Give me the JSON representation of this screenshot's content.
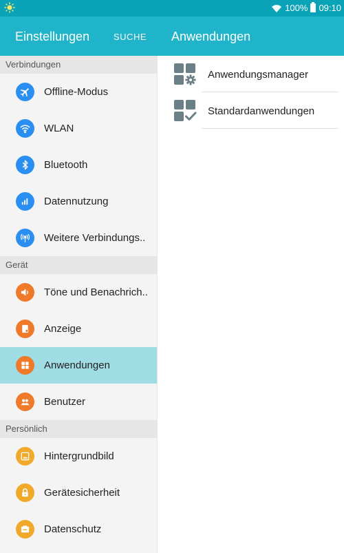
{
  "status_bar": {
    "battery_text": "100%",
    "time": "09:10",
    "icons": [
      "sun-icon",
      "wifi-icon",
      "battery-icon"
    ]
  },
  "header": {
    "left_title": "Einstellungen",
    "search_label": "SUCHE",
    "right_title": "Anwendungen"
  },
  "sections": [
    {
      "title": "Verbindungen",
      "items": [
        {
          "label": "Offline-Modus",
          "icon": "airplane-icon",
          "color": "#2a8ff0"
        },
        {
          "label": "WLAN",
          "icon": "wifi-icon",
          "color": "#2a8ff0"
        },
        {
          "label": "Bluetooth",
          "icon": "bluetooth-icon",
          "color": "#2a8ff0"
        },
        {
          "label": "Datennutzung",
          "icon": "data-usage-icon",
          "color": "#2a8ff0"
        },
        {
          "label": "Weitere Verbindungs..",
          "icon": "more-connections-icon",
          "color": "#2a8ff0"
        }
      ]
    },
    {
      "title": "Gerät",
      "items": [
        {
          "label": "Töne und Benachrich..",
          "icon": "sound-icon",
          "color": "#ee7a2a"
        },
        {
          "label": "Anzeige",
          "icon": "display-icon",
          "color": "#ee7a2a"
        },
        {
          "label": "Anwendungen",
          "icon": "apps-icon",
          "color": "#ee7a2a",
          "active": true
        },
        {
          "label": "Benutzer",
          "icon": "users-icon",
          "color": "#ee7a2a"
        }
      ]
    },
    {
      "title": "Persönlich",
      "items": [
        {
          "label": "Hintergrundbild",
          "icon": "wallpaper-icon",
          "color": "#f0a92a"
        },
        {
          "label": "Gerätesicherheit",
          "icon": "lock-icon",
          "color": "#f0a92a"
        },
        {
          "label": "Datenschutz",
          "icon": "privacy-icon",
          "color": "#f0a92a"
        }
      ]
    }
  ],
  "right_items": [
    {
      "label": "Anwendungsmanager",
      "icon": "app-manager-icon"
    },
    {
      "label": "Standardanwendungen",
      "icon": "default-apps-icon"
    }
  ],
  "colors": {
    "status_bar": "#0aa3b7",
    "header": "#1fb4c9",
    "active_item": "#9fdce4",
    "icon_grey": "#6b7f87"
  }
}
